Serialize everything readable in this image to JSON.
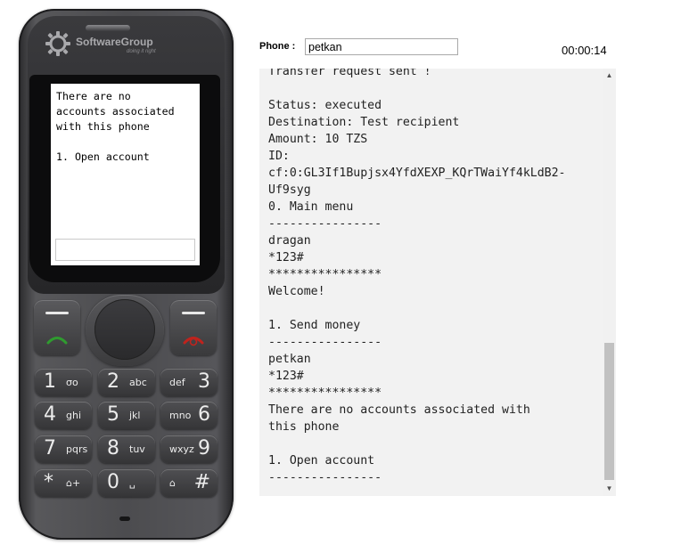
{
  "phone_device": {
    "brand_name": "SoftwareGroup",
    "brand_tagline": "doing it right",
    "screen_text": "There are no\naccounts associated\nwith this phone\n\n1. Open account",
    "screen_input_value": "",
    "keys": [
      {
        "num": "1",
        "sub": "σο"
      },
      {
        "num": "2",
        "sub": "abc"
      },
      {
        "num": "3",
        "sub": "def"
      },
      {
        "num": "4",
        "sub": "ghi"
      },
      {
        "num": "5",
        "sub": "jkl"
      },
      {
        "num": "6",
        "sub": "mno"
      },
      {
        "num": "7",
        "sub": "pqrs"
      },
      {
        "num": "8",
        "sub": "tuv"
      },
      {
        "num": "9",
        "sub": "wxyz"
      },
      {
        "num": "*",
        "sub": "⌂+"
      },
      {
        "num": "0",
        "sub": "␣"
      },
      {
        "num": "#",
        "sub": "⌂"
      }
    ],
    "call_color": "#2f9b2f",
    "end_color": "#c0231d"
  },
  "controls": {
    "phone_label": "Phone :",
    "phone_value": "petkan",
    "timer": "00:00:14"
  },
  "log": {
    "text": "Transfer request sent !\n\nStatus: executed\nDestination: Test recipient\nAmount: 10 TZS\nID:\ncf:0:GL3If1Bupjsx4YfdXEXP_KQrTWaiYf4kLdB2-\nUf9syg\n0. Main menu\n----------------\ndragan\n*123#\n****************\nWelcome!\n\n1. Send money\n----------------\npetkan\n*123#\n****************\nThere are no accounts associated with\nthis phone\n\n1. Open account\n----------------"
  }
}
